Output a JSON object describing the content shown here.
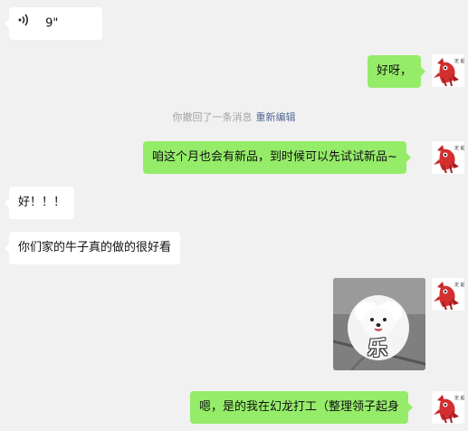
{
  "messages": [
    {
      "side": "in",
      "type": "voice",
      "icon": "voice-wave-icon",
      "text": "9\""
    },
    {
      "side": "out",
      "type": "text",
      "text": "好呀，"
    },
    {
      "side": "out",
      "type": "text",
      "text": "咱这个月也会有新品，到时候可以先试试新品~"
    },
    {
      "side": "in",
      "type": "text",
      "text": "好！！！"
    },
    {
      "side": "in",
      "type": "text",
      "text": "你们家的牛子真的做的很好看"
    },
    {
      "side": "out",
      "type": "sticker",
      "caption": "乐"
    },
    {
      "side": "out",
      "type": "text",
      "text": "嗯，是的我在幻龙打工（整理领子起身"
    }
  ],
  "system": {
    "recall_text": "你撤回了一条消息",
    "reedit_label": "重新编辑"
  },
  "avatar": {
    "icon": "red-dragon-avatar-icon"
  },
  "colors": {
    "background": "#f1f1f1",
    "incoming_bubble": "#ffffff",
    "outgoing_bubble": "#95ec69",
    "link": "#576b95"
  }
}
